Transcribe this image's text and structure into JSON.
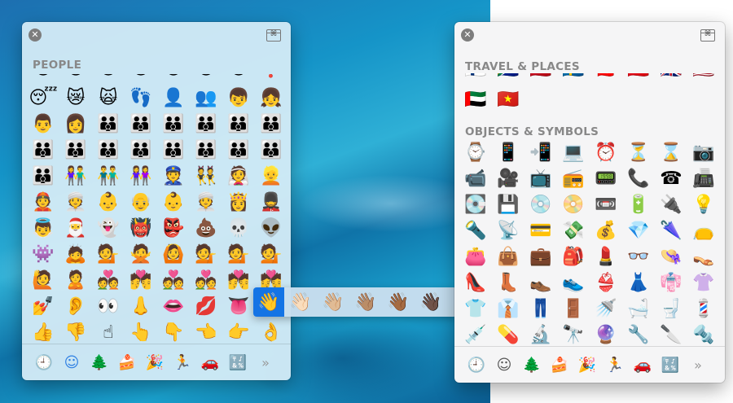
{
  "left_panel": {
    "close_icon": "✕",
    "viewer_icon": "⌘",
    "section_title": "PEOPLE",
    "partial_row": [
      "😄",
      "😺",
      "😹",
      "🙀",
      "😼",
      "😊",
      "😐",
      "❓"
    ],
    "emoji": [
      "😴",
      "😿",
      "🙀",
      "👣",
      "👤",
      "👥",
      "👦",
      "👧",
      "👨",
      "👩",
      "👪",
      "👪",
      "👪",
      "👪",
      "👪",
      "👪",
      "👪",
      "👪",
      "👪",
      "👪",
      "👪",
      "👪",
      "👪",
      "👪",
      "👪",
      "👫",
      "👬",
      "👭",
      "👮",
      "👯",
      "👰",
      "👱",
      "👲",
      "👳",
      "👶",
      "👴",
      "👶",
      "👳",
      "👸",
      "💂",
      "👼",
      "🎅",
      "👻",
      "👹",
      "👺",
      "💩",
      "💀",
      "👽",
      "👾",
      "🙇",
      "💁",
      "🙅",
      "🙆",
      "💁",
      "💁",
      "💁",
      "🙋",
      "🙎",
      "💑",
      "💏",
      "💑",
      "💑",
      "💏",
      "💏",
      "💅",
      "👂",
      "👀",
      "👃",
      "👄",
      "💋",
      "👅",
      "👋",
      "👍",
      "👎",
      "☝",
      "👆",
      "👇",
      "👈",
      "👉",
      "👌"
    ],
    "skin_tones": [
      "👋",
      "👋🏻",
      "👋🏼",
      "👋🏽",
      "👋🏾",
      "👋🏿"
    ],
    "toolbar": [
      {
        "icon": "clock-icon",
        "glyph": "🕘"
      },
      {
        "icon": "smiley-icon",
        "glyph": "☺"
      },
      {
        "icon": "tree-icon",
        "glyph": "🌲"
      },
      {
        "icon": "cake-icon",
        "glyph": "🍰"
      },
      {
        "icon": "party-popper-icon",
        "glyph": "🎉"
      },
      {
        "icon": "runner-icon",
        "glyph": "🏃"
      },
      {
        "icon": "car-icon",
        "glyph": "🚗"
      },
      {
        "icon": "symbols-icon",
        "glyph": "🔣"
      },
      {
        "icon": "more-chevron-icon",
        "glyph": "»"
      }
    ]
  },
  "right_panel": {
    "close_icon": "✕",
    "viewer_icon": "⌘",
    "section_title_travel": "TRAVEL & PLACES",
    "flags_partial": [
      "🇫🇮",
      "🇿🇦",
      "🇪🇸",
      "🇸🇪",
      "🇨🇭",
      "🇹🇷",
      "🇬🇧",
      "🇺🇸"
    ],
    "flags": [
      "🇦🇪",
      "🇻🇳"
    ],
    "section_title_objects": "OBJECTS & SYMBOLS",
    "emoji": [
      "⌚",
      "📱",
      "📲",
      "💻",
      "⏰",
      "⏳",
      "⌛",
      "📷",
      "📹",
      "🎥",
      "📺",
      "📻",
      "📟",
      "📞",
      "☎",
      "📠",
      "💽",
      "💾",
      "💿",
      "📀",
      "📼",
      "🔋",
      "🔌",
      "💡",
      "🔦",
      "📡",
      "💳",
      "💸",
      "💰",
      "💎",
      "🌂",
      "👝",
      "👛",
      "👜",
      "💼",
      "🎒",
      "💄",
      "👓",
      "👒",
      "👡",
      "👠",
      "👢",
      "👞",
      "👟",
      "👙",
      "👗",
      "👘",
      "👚",
      "👕",
      "👔",
      "👖",
      "🚪",
      "🚿",
      "🛁",
      "🚽",
      "💈",
      "💉",
      "💊",
      "🔬",
      "🔭",
      "🔮",
      "🔧",
      "🔪",
      "🔩"
    ],
    "toolbar": [
      {
        "icon": "clock-icon",
        "glyph": "🕘"
      },
      {
        "icon": "smiley-icon",
        "glyph": "☺"
      },
      {
        "icon": "tree-icon",
        "glyph": "🌲"
      },
      {
        "icon": "cake-icon",
        "glyph": "🍰"
      },
      {
        "icon": "party-popper-icon",
        "glyph": "🎉"
      },
      {
        "icon": "runner-icon",
        "glyph": "🏃"
      },
      {
        "icon": "car-icon",
        "glyph": "🚗"
      },
      {
        "icon": "symbols-icon",
        "glyph": "🔣"
      },
      {
        "icon": "more-chevron-icon",
        "glyph": "»"
      }
    ]
  },
  "colors": {
    "accent": "#1474e5",
    "section_title": "#888888"
  }
}
